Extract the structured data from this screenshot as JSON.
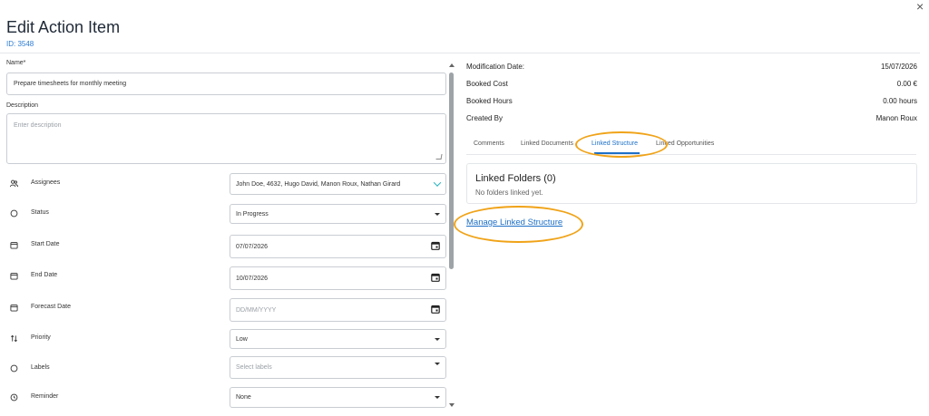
{
  "header": {
    "title": "Edit Action Item",
    "id_text": "ID: 3548",
    "close_glyph": "×"
  },
  "form": {
    "name": {
      "label": "Name*",
      "value": "Prepare timesheets for monthly meeting"
    },
    "description": {
      "label": "Description",
      "placeholder": "Enter description"
    },
    "rows": {
      "assignees": {
        "label": "Assignees",
        "value": "John Doe, 4632, Hugo David, Manon Roux, Nathan Girard",
        "icon": "people-icon"
      },
      "status": {
        "label": "Status",
        "value": "In Progress",
        "icon": "circle-icon"
      },
      "start_date": {
        "label": "Start Date",
        "value": "07/07/2026",
        "icon": "calendar-icon"
      },
      "end_date": {
        "label": "End Date",
        "value": "10/07/2026",
        "icon": "calendar-icon"
      },
      "forecast_date": {
        "label": "Forecast Date",
        "placeholder": "DD/MM/YYYY",
        "icon": "calendar-icon"
      },
      "priority": {
        "label": "Priority",
        "value": "Low",
        "icon": "sort-arrows-icon"
      },
      "labels": {
        "label": "Labels",
        "placeholder": "Select labels",
        "icon": "circle-icon"
      },
      "reminder": {
        "label": "Reminder",
        "value": "None",
        "icon": "clock-icon"
      }
    }
  },
  "info": {
    "modification_date": {
      "label": "Modification Date:",
      "value": "15/07/2026"
    },
    "booked_cost": {
      "label": "Booked Cost",
      "value": "0.00 €"
    },
    "booked_hours": {
      "label": "Booked Hours",
      "value": "0.00 hours"
    },
    "created_by": {
      "label": "Created By",
      "value": "Manon Roux"
    }
  },
  "tabs": [
    {
      "label": "Comments",
      "active": false
    },
    {
      "label": "Linked Documents",
      "active": false
    },
    {
      "label": "Linked Structure",
      "active": true
    },
    {
      "label": "Linked Opportunities",
      "active": false
    }
  ],
  "linked_structure": {
    "title": "Linked Folders (0)",
    "empty_text": "No folders linked yet.",
    "manage_link": "Manage Linked Structure"
  },
  "colors": {
    "accent": "#1d6fc7",
    "highlight": "#f0a318",
    "teal": "#2bb3c0"
  }
}
